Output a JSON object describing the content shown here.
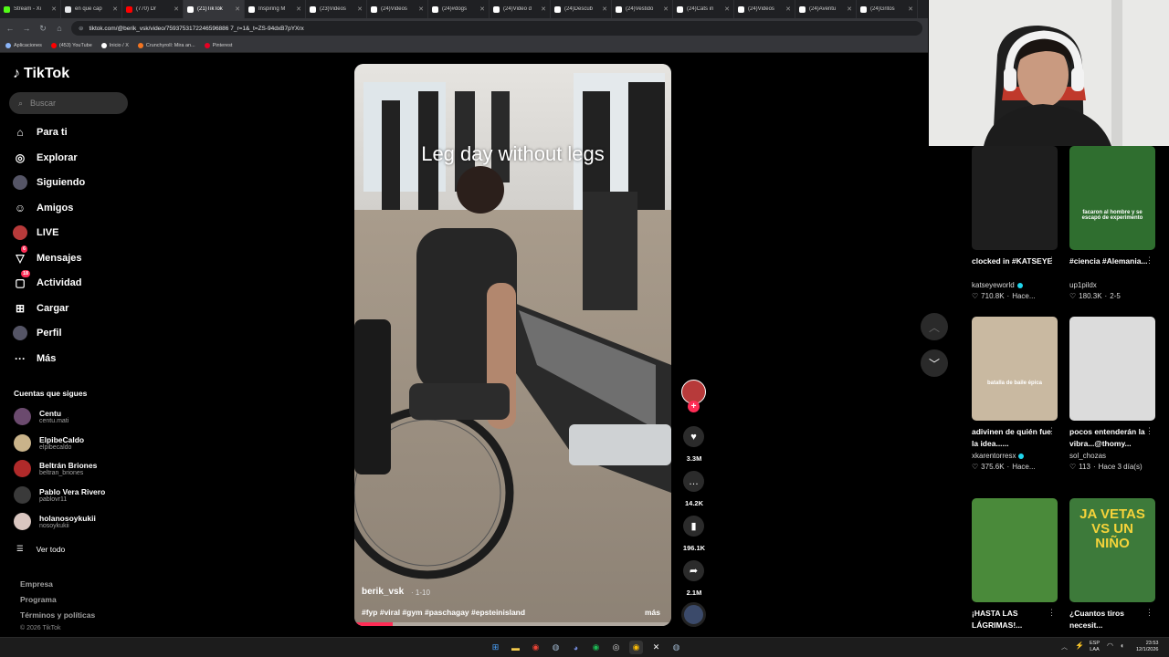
{
  "browser": {
    "tabs": [
      {
        "label": "Stream - Xi",
        "color": "#53fc18"
      },
      {
        "label": "en que cap",
        "color": "#e8eaed"
      },
      {
        "label": "(770) Dr",
        "color": "#ff0000"
      },
      {
        "label": "(21)TikTok",
        "color": "#ffffff"
      },
      {
        "label": "Inspiring M",
        "color": "#ffffff"
      },
      {
        "label": "(23)Videos",
        "color": "#ffffff"
      },
      {
        "label": "(24)Videos",
        "color": "#ffffff"
      },
      {
        "label": "(24)#dogs",
        "color": "#ffffff"
      },
      {
        "label": "(24)Video d",
        "color": "#ffffff"
      },
      {
        "label": "(24)Descub",
        "color": "#ffffff"
      },
      {
        "label": "(24)Vestido",
        "color": "#ffffff"
      },
      {
        "label": "(24)Cats in",
        "color": "#ffffff"
      },
      {
        "label": "(24)Videos",
        "color": "#ffffff"
      },
      {
        "label": "(24)Aventu",
        "color": "#ffffff"
      },
      {
        "label": "(24)Gritos",
        "color": "#ffffff"
      }
    ],
    "url": "tiktok.com/@berik_vsk/video/7593753172246596886 7_r=1&_t=ZS-94dxB7pYXrx",
    "bookmarks": [
      {
        "label": "Aplicaciones",
        "color": "#8ab4f8"
      },
      {
        "label": "(453) YouTube",
        "color": "#ff0000"
      },
      {
        "label": "Inicio / X",
        "color": "#ffffff"
      },
      {
        "label": "Crunchyroll: Mira an...",
        "color": "#f47521"
      },
      {
        "label": "Pinterest",
        "color": "#e60023"
      }
    ]
  },
  "sidebar": {
    "logo": "TikTok",
    "search_placeholder": "Buscar",
    "nav": [
      {
        "label": "Para ti",
        "icon": "home-icon",
        "glyph": "⌂"
      },
      {
        "label": "Explorar",
        "icon": "compass-icon",
        "glyph": "◎"
      },
      {
        "label": "Siguiendo",
        "icon": "following-avatar-icon",
        "glyph": "●"
      },
      {
        "label": "Amigos",
        "icon": "friends-icon",
        "glyph": "☺"
      },
      {
        "label": "LIVE",
        "icon": "live-avatar-icon",
        "glyph": "●"
      },
      {
        "label": "Mensajes",
        "icon": "messages-icon",
        "glyph": "▽",
        "badge": "6"
      },
      {
        "label": "Actividad",
        "icon": "activity-icon",
        "glyph": "▢",
        "badge": "18"
      },
      {
        "label": "Cargar",
        "icon": "upload-icon",
        "glyph": "⊞"
      },
      {
        "label": "Perfil",
        "icon": "profile-avatar-icon",
        "glyph": "●"
      },
      {
        "label": "Más",
        "icon": "more-icon",
        "glyph": "···"
      }
    ],
    "following_title": "Cuentas que sigues",
    "accounts": [
      {
        "name": "Centu",
        "username": "centu.mati",
        "color": "#6b4a6e"
      },
      {
        "name": "ElpibeCaldo",
        "username": "elpibecaldo",
        "color": "#c9b38a"
      },
      {
        "name": "Beltrán Briones",
        "username": "beltran_briones",
        "color": "#b02a2a"
      },
      {
        "name": "Pablo Vera Rivero",
        "username": "pablovr11",
        "color": "#3a3a3a"
      },
      {
        "name": "holanosoykukii",
        "username": "nosoykukii",
        "color": "#d9c6c0"
      }
    ],
    "see_all": "Ver todo",
    "footer": [
      "Empresa",
      "Programa",
      "Términos y políticas"
    ],
    "copyright": "© 2026 TikTok"
  },
  "video": {
    "overlay_text": "Leg day without legs",
    "author": "berik_vsk",
    "date": "· 1-10",
    "hashtags": "#fyp #viral #gym #paschagay #epsteinisland",
    "more": "más",
    "progress": 0.12
  },
  "actions": [
    {
      "name": "like",
      "icon": "heart-icon",
      "glyph": "♥",
      "count": "3.3M"
    },
    {
      "name": "comment",
      "icon": "comment-icon",
      "glyph": "…",
      "count": "14.2K"
    },
    {
      "name": "save",
      "icon": "bookmark-icon",
      "glyph": "▮",
      "count": "196.1K"
    },
    {
      "name": "share",
      "icon": "share-icon",
      "glyph": "➦",
      "count": "2.1M"
    }
  ],
  "recommended": [
    {
      "title": "clocked in #KATSEYE",
      "author": "katseyeworld",
      "verified": true,
      "likes": "710.8K",
      "time": "Hace...",
      "bg": "#1e1e1e"
    },
    {
      "title": "#ciencia #Alemania...",
      "author": "up1pildx",
      "verified": false,
      "likes": "180.3K",
      "time": "2-5",
      "bg": "#2f6e2f",
      "thumb_text": "facaron al hombre y se escapó de experimento"
    },
    {
      "title": "adivinen de quién fue la idea......",
      "author": "xkarentorresx",
      "verified": true,
      "likes": "375.6K",
      "time": "Hace...",
      "bg": "#c9b9a1",
      "thumb_text": "batalla de baile épica"
    },
    {
      "title": "pocos entenderán la vibra...@thomy...",
      "author": "sol_chozas",
      "verified": false,
      "likes": "113",
      "time": "Hace 3 día(s)",
      "bg": "#dcdcdc"
    },
    {
      "title": "¡HASTA LAS LÁGRIMAS!...",
      "author": "",
      "verified": false,
      "likes": "",
      "time": "",
      "bg": "#4a8a3a"
    },
    {
      "title": "¿Cuantos tiros necesit...",
      "author": "",
      "verified": false,
      "likes": "",
      "time": "",
      "bg": "#3d7a3a",
      "thumb_text": "JA VETAS VS UN NIÑO"
    }
  ],
  "taskbar": {
    "lang": [
      "ESP",
      "LAA"
    ],
    "time": "23:53",
    "date": "12/1/2026"
  }
}
